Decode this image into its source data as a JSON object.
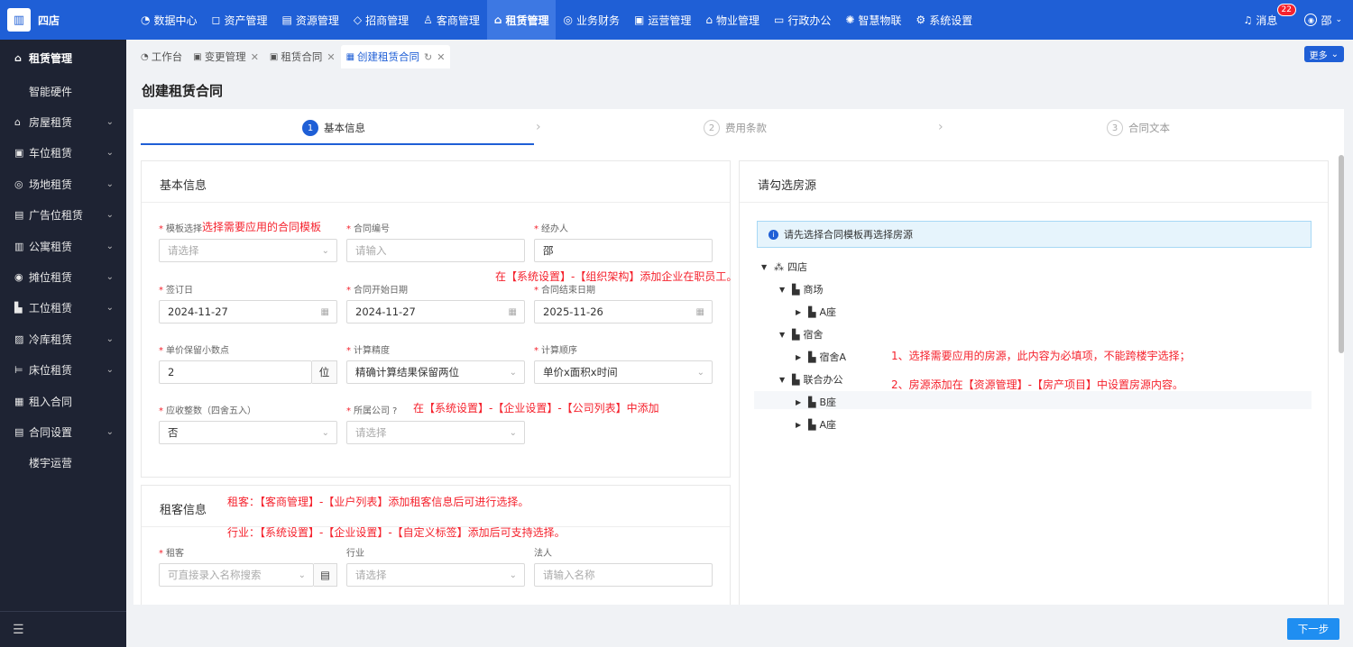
{
  "app": {
    "logo_glyph": "▥",
    "name": "四店"
  },
  "nav": [
    {
      "icon": "◔",
      "label": "数据中心"
    },
    {
      "icon": "◻",
      "label": "资产管理"
    },
    {
      "icon": "▤",
      "label": "资源管理"
    },
    {
      "icon": "◇",
      "label": "招商管理"
    },
    {
      "icon": "♙",
      "label": "客商管理"
    },
    {
      "icon": "⌂",
      "label": "租赁管理"
    },
    {
      "icon": "◎",
      "label": "业务财务"
    },
    {
      "icon": "▣",
      "label": "运营管理"
    },
    {
      "icon": "⌂",
      "label": "物业管理"
    },
    {
      "icon": "▭",
      "label": "行政办公"
    },
    {
      "icon": "✺",
      "label": "智慧物联"
    },
    {
      "icon": "⚙",
      "label": "系统设置"
    }
  ],
  "top_right": {
    "message_label": "消息",
    "message_count": "22",
    "user_name": "邵"
  },
  "sidebar": {
    "head": "租赁管理",
    "items": [
      {
        "label": "智能硬件",
        "icon": ""
      },
      {
        "label": "房屋租赁",
        "icon": "⌂"
      },
      {
        "label": "车位租赁",
        "icon": "▣"
      },
      {
        "label": "场地租赁",
        "icon": "◎"
      },
      {
        "label": "广告位租赁",
        "icon": "▤"
      },
      {
        "label": "公寓租赁",
        "icon": "▥"
      },
      {
        "label": "摊位租赁",
        "icon": "◉"
      },
      {
        "label": "工位租赁",
        "icon": "▙"
      },
      {
        "label": "冷库租赁",
        "icon": "▨"
      },
      {
        "label": "床位租赁",
        "icon": "⊨"
      },
      {
        "label": "租入合同",
        "icon": "▦"
      },
      {
        "label": "合同设置",
        "icon": "▤"
      },
      {
        "label": "楼宇运营",
        "icon": ""
      }
    ],
    "collapse_glyph": "☰"
  },
  "tabs": [
    {
      "label": "工作台",
      "icon": "◔",
      "closable": false
    },
    {
      "label": "变更管理",
      "icon": "▣",
      "closable": true
    },
    {
      "label": "租赁合同",
      "icon": "▣",
      "closable": true
    },
    {
      "label": "创建租赁合同",
      "icon": "▦",
      "closable": true
    }
  ],
  "more_label": "更多",
  "page_title": "创建租赁合同",
  "steps": [
    {
      "num": "1",
      "label": "基本信息"
    },
    {
      "num": "2",
      "label": "费用条款"
    },
    {
      "num": "3",
      "label": "合同文本"
    }
  ],
  "basic": {
    "title": "基本信息",
    "template_label": "模板选择",
    "template_placeholder": "请选择",
    "contract_no_label": "合同编号",
    "contract_no_placeholder": "请输入",
    "handler_label": "经办人",
    "handler_value": "邵",
    "sign_date_label": "签订日",
    "sign_date_value": "2024-11-27",
    "start_date_label": "合同开始日期",
    "start_date_value": "2024-11-27",
    "end_date_label": "合同结束日期",
    "end_date_value": "2025-11-26",
    "decimal_label": "单价保留小数点",
    "decimal_value": "2",
    "decimal_unit": "位",
    "precision_label": "计算精度",
    "precision_value": "精确计算结果保留两位",
    "order_label": "计算顺序",
    "order_value": "单价x面积x时间",
    "receivable_label": "应收整数（四舍五入）",
    "receivable_value": "否",
    "company_label": "所属公司",
    "company_placeholder": "请选择"
  },
  "tenant": {
    "title": "租客信息",
    "tenant_label": "租客",
    "tenant_placeholder": "可直接录入名称搜索",
    "industry_label": "行业",
    "industry_placeholder": "请选择",
    "legal_label": "法人",
    "legal_placeholder": "请输入名称"
  },
  "notes": {
    "template": "选择需要应用的合同模板",
    "handler": "在【系统设置】-【组织架构】添加企业在职员工。",
    "company": "在【系统设置】-【企业设置】-【公司列表】中添加",
    "tenant": "租客：【客商管理】-【业户列表】添加租客信息后可进行选择。",
    "industry": "行业：【系统设置】-【企业设置】-【自定义标签】添加后可支持选择。",
    "room1": "1、选择需要应用的房源，此内容为必填项，不能跨楼宇选择；",
    "room2": "2、房源添加在【资源管理】-【房产项目】中设置房源内容。"
  },
  "rooms": {
    "title": "请勾选房源",
    "info": "请先选择合同模板再选择房源",
    "tree": [
      {
        "label": "四店",
        "level": 0
      },
      {
        "label": "商场",
        "level": 1
      },
      {
        "label": "A座",
        "level": 2
      },
      {
        "label": "宿舍",
        "level": 1
      },
      {
        "label": "宿舍A",
        "level": 2
      },
      {
        "label": "联合办公",
        "level": 1
      },
      {
        "label": "B座",
        "level": 2
      },
      {
        "label": "A座",
        "level": 2
      }
    ]
  },
  "next_label": "下一步"
}
